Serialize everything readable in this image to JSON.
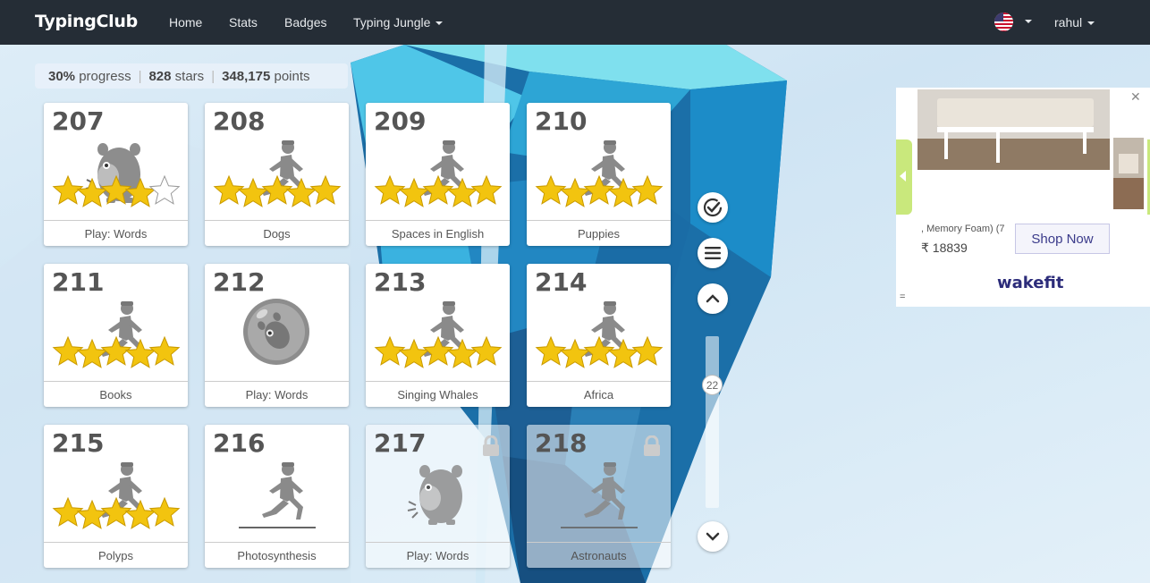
{
  "navbar": {
    "brand": "TypingClub",
    "links": [
      "Home",
      "Stats",
      "Badges",
      "Typing Jungle"
    ],
    "user": "rahul"
  },
  "progress": {
    "percent": "30%",
    "percent_label": "progress",
    "stars": "828",
    "stars_label": "stars",
    "points": "348,175",
    "points_label": "points"
  },
  "lessons": [
    {
      "num": "207",
      "label": "Play: Words",
      "icon": "monster-icon",
      "stars": 4,
      "locked": false
    },
    {
      "num": "208",
      "label": "Dogs",
      "icon": "runner-icon",
      "stars": 5,
      "locked": false
    },
    {
      "num": "209",
      "label": "Spaces in English",
      "icon": "runner-icon",
      "stars": 5,
      "locked": false
    },
    {
      "num": "210",
      "label": "Puppies",
      "icon": "runner-icon",
      "stars": 5,
      "locked": false
    },
    {
      "num": "211",
      "label": "Books",
      "icon": "runner-icon",
      "stars": 5,
      "locked": false
    },
    {
      "num": "212",
      "label": "Play: Words",
      "icon": "game-bubble-icon",
      "stars": 0,
      "locked": false
    },
    {
      "num": "213",
      "label": "Singing Whales",
      "icon": "runner-icon",
      "stars": 5,
      "locked": false
    },
    {
      "num": "214",
      "label": "Africa",
      "icon": "runner-icon",
      "stars": 5,
      "locked": false
    },
    {
      "num": "215",
      "label": "Polyps",
      "icon": "runner-icon",
      "stars": 5,
      "locked": false
    },
    {
      "num": "216",
      "label": "Photosynthesis",
      "icon": "runner-icon",
      "stars": 0,
      "locked": false
    },
    {
      "num": "217",
      "label": "Play: Words",
      "icon": "monster-icon",
      "stars": 0,
      "locked": true
    },
    {
      "num": "218",
      "label": "Astronauts",
      "icon": "runner-icon",
      "stars": 0,
      "locked": true
    }
  ],
  "scroll": {
    "position_label": "22"
  },
  "ad": {
    "description": ", Memory Foam) (7",
    "price": "₹ 18839",
    "cta": "Shop Now",
    "brand": "wakefit",
    "menu": "="
  },
  "colors": {
    "navbar": "#252d36",
    "star": "#f2c40f",
    "crystal": "#1f7fb8"
  }
}
